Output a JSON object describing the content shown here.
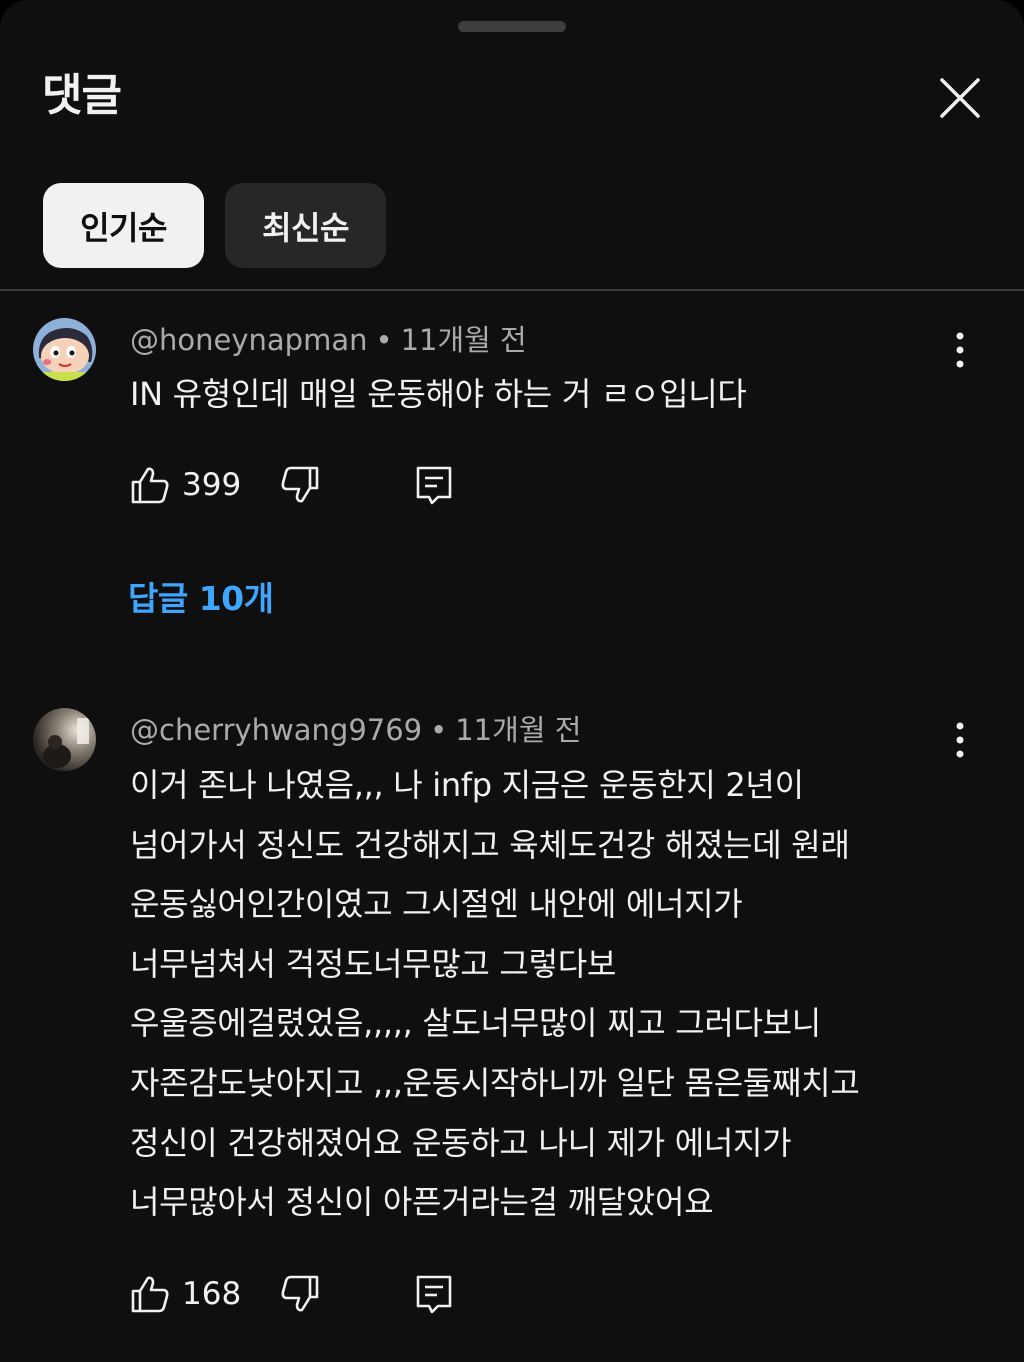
{
  "header": {
    "title": "댓글",
    "close_icon": "close-icon"
  },
  "sort_tabs": [
    {
      "label": "인기순",
      "active": true
    },
    {
      "label": "최신순",
      "active": false
    }
  ],
  "comments": [
    {
      "author": "@honeynapman",
      "separator": "•",
      "time": "11개월 전",
      "text_lines": [
        "IN 유형인데 매일 운동해야 하는 거 ㄹㅇ입니다"
      ],
      "likes": "399",
      "replies_label": "답글 10개"
    },
    {
      "author": "@cherryhwang9769",
      "separator": "•",
      "time": "11개월 전",
      "text_lines": [
        "이거 존나 나였음,,, 나 infp 지금은 운동한지 2년이",
        "넘어가서 정신도 건강해지고 육체도건강 해졌는데 원래",
        "운동싫어인간이였고 그시절엔 내안에 에너지가",
        "너무넘쳐서 걱정도너무많고 그렇다보",
        "우울증에걸렸었음,,,,, 살도너무많이 찌고 그러다보니",
        "자존감도낮아지고 ,,,운동시작하니까 일단 몸은둘째치고",
        "정신이 건강해졌어요 운동하고 나니 제가 에너지가",
        "너무많아서 정신이 아픈거라는걸 깨달았어요"
      ],
      "likes": "168"
    }
  ],
  "colors": {
    "background": "#0f0f0f",
    "text_primary": "#f1f1f1",
    "text_secondary": "#aaaaaa",
    "link_blue": "#3ea6ff",
    "chip_active_bg": "#f1f1f1",
    "chip_inactive_bg": "#272727"
  }
}
